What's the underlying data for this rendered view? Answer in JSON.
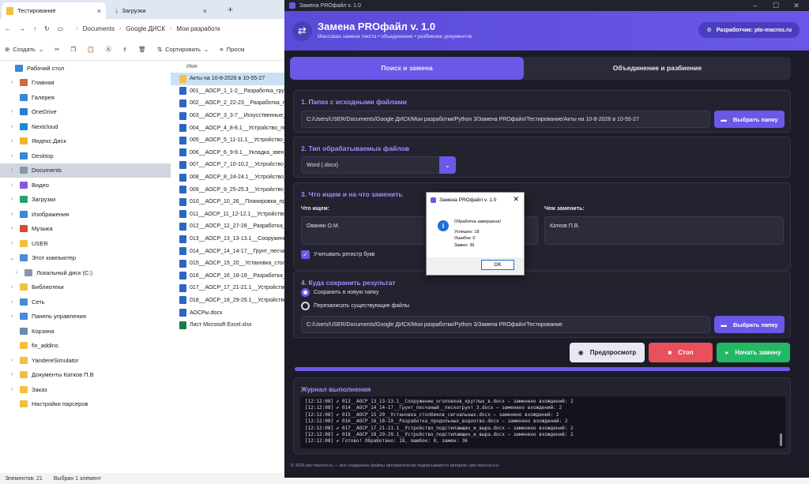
{
  "explorer": {
    "tabs": [
      {
        "label": "Тестирование"
      },
      {
        "label": "Загрузки"
      }
    ],
    "breadcrumb": [
      "Documents",
      "Google ДИСК",
      "Мои разработк"
    ],
    "toolbar": {
      "create": "Создать",
      "sort": "Сортировать",
      "view": "Просм"
    },
    "nav": [
      {
        "label": "Рабочий стол",
        "color": "#3a86d8",
        "chev": "",
        "sel": false,
        "indent": 0
      },
      {
        "label": "Главная",
        "color": "#d46a3a",
        "chev": "›",
        "sel": false,
        "indent": 1
      },
      {
        "label": "Галерея",
        "color": "#3a86d8",
        "chev": "",
        "sel": false,
        "indent": 1
      },
      {
        "label": "OneDrive",
        "color": "#2a7cd6",
        "chev": "›",
        "sel": false,
        "indent": 1
      },
      {
        "label": "Nextcloud",
        "color": "#1a8ad6",
        "chev": "›",
        "sel": false,
        "indent": 1
      },
      {
        "label": "Яндекс.Диск",
        "color": "#f0b429",
        "chev": "›",
        "sel": false,
        "indent": 1
      },
      {
        "label": "Desktop",
        "color": "#3a86d8",
        "chev": "›",
        "sel": false,
        "indent": 1
      },
      {
        "label": "Documents",
        "color": "#8a96a8",
        "chev": "›",
        "sel": true,
        "indent": 1
      },
      {
        "label": "Видео",
        "color": "#8a5ad6",
        "chev": "›",
        "sel": false,
        "indent": 1
      },
      {
        "label": "Загрузки",
        "color": "#2aa06a",
        "chev": "›",
        "sel": false,
        "indent": 1
      },
      {
        "label": "Изображения",
        "color": "#3a86d8",
        "chev": "›",
        "sel": false,
        "indent": 1
      },
      {
        "label": "Музыка",
        "color": "#d64a3a",
        "chev": "›",
        "sel": false,
        "indent": 1
      },
      {
        "label": "USER",
        "color": "#f0c040",
        "chev": "›",
        "sel": false,
        "indent": 1
      },
      {
        "label": "Этот компьютер",
        "color": "#4a8ad6",
        "chev": "⌄",
        "sel": false,
        "indent": 1
      },
      {
        "label": "Локальный диск (C:)",
        "color": "#8a96a8",
        "chev": "›",
        "sel": false,
        "indent": 2
      },
      {
        "label": "Библиотеки",
        "color": "#f0c040",
        "chev": "›",
        "sel": false,
        "indent": 1
      },
      {
        "label": "Сеть",
        "color": "#4a8ad6",
        "chev": "›",
        "sel": false,
        "indent": 1
      },
      {
        "label": "Панель управления",
        "color": "#4a8ad6",
        "chev": "›",
        "sel": false,
        "indent": 1
      },
      {
        "label": "Корзина",
        "color": "#6a8ab0",
        "chev": "",
        "sel": false,
        "indent": 1
      },
      {
        "label": "fix_addins",
        "color": "#f0c040",
        "chev": "",
        "sel": false,
        "indent": 1
      },
      {
        "label": "YandereSimulator",
        "color": "#f0c040",
        "chev": "›",
        "sel": false,
        "indent": 1
      },
      {
        "label": "Документы Катков П.В",
        "color": "#f0c040",
        "chev": "›",
        "sel": false,
        "indent": 1
      },
      {
        "label": "Заказ",
        "color": "#f0c040",
        "chev": "›",
        "sel": false,
        "indent": 1
      },
      {
        "label": "Настройки парсеров",
        "color": "#f0c040",
        "chev": "",
        "sel": false,
        "indent": 1
      }
    ],
    "files_header": "Имя",
    "files": [
      {
        "name": "Акты на 10-8-2026 в 10-55-27",
        "kind": "folder",
        "sel": true
      },
      {
        "name": "001__АОСР_1_1-2__Разработка_грунт",
        "kind": "word",
        "sel": false
      },
      {
        "name": "002__АОСР_2_22-23__Разработка_гру",
        "kind": "word",
        "sel": false
      },
      {
        "name": "003__АОСР_3_3-7__Искусственные_с",
        "kind": "word",
        "sel": false
      },
      {
        "name": "004__АОСР_4_8-8.1__Устройство_под",
        "kind": "word",
        "sel": false
      },
      {
        "name": "005__АОСР_5_11-11.1__Устройство_п",
        "kind": "word",
        "sel": false
      },
      {
        "name": "006__АОСР_6_9-9.1__Укладка_звенье",
        "kind": "word",
        "sel": false
      },
      {
        "name": "007__АОСР_7_10-10.2__Устройство_п",
        "kind": "word",
        "sel": false
      },
      {
        "name": "008__АОСР_8_24-24.1__Устройство_п",
        "kind": "word",
        "sel": false
      },
      {
        "name": "009__АОСР_9_25-25.3__Устройство_п",
        "kind": "word",
        "sel": false
      },
      {
        "name": "010__АОСР_10_26__Планировка_при",
        "kind": "word",
        "sel": false
      },
      {
        "name": "011__АОСР_11_12-12.1__Устройство_",
        "kind": "word",
        "sel": false
      },
      {
        "name": "012__АОСР_12_27-28__Разработка_гр",
        "kind": "word",
        "sel": false
      },
      {
        "name": "013__АОСР_13_13-13.1__Сооружение_",
        "kind": "word",
        "sel": false
      },
      {
        "name": "014__АОСР_14_14-17__Грунт_песчаны",
        "kind": "word",
        "sel": false
      },
      {
        "name": "015__АОСР_15_20__Установка_столби",
        "kind": "word",
        "sel": false
      },
      {
        "name": "016__АОСР_16_18-19__Разработка_пр",
        "kind": "word",
        "sel": false
      },
      {
        "name": "017__АОСР_17_21-21.1__Устройство_",
        "kind": "word",
        "sel": false
      },
      {
        "name": "018__АОСР_18_29-29.1__Устройство_",
        "kind": "word",
        "sel": false
      },
      {
        "name": "АОСРы.docx",
        "kind": "word",
        "sel": false
      },
      {
        "name": "Лист Microsoft Excel.xlsx",
        "kind": "excel",
        "sel": false
      }
    ],
    "status": {
      "count": "Элементов: 21",
      "selected": "Выбран 1 элемент"
    }
  },
  "app": {
    "window_title": "Замена PROфайл v. 1.0",
    "title": "Замена PROфайл v. 1.0",
    "subtitle": "Массовая замена текста  •  объединение  •  разбиение документов",
    "dev_button": "Разработчик: pto-macros.ru",
    "tab_search": "Поиск и замена",
    "tab_merge": "Объединение и разбиение",
    "s1_title": "1.  Папка с исходными файлами",
    "s1_path": "C:/Users/USER/Documents/Google ДИСК/Мои разработки/Python 3/Замена PROфайл/Тестирование/Акты на 10-8-2026 в 10-55-27",
    "browse": "Выбрать папку",
    "s2_title": "2.  Тип обрабатываемых файлов",
    "filetype": "Word (.docx)",
    "s3_title": "3.  Что ищем и на что заменить",
    "find_label": "Что ищем:",
    "find_value": "Ованян О.М.",
    "replace_label": "Чем заменить:",
    "replace_value": "Катков П.В.",
    "case_label": "Учитывать регистр букв",
    "s4_title": "4.  Куда сохранить результат",
    "opt_new": "Сохранить в новую папку",
    "opt_overwrite": "Перезаписать существующие файлы",
    "s4_path": "C:/Users/USER/Documents/Google ДИСК/Мои разработки/Python 3/Замена PROфайл/Тестирование",
    "btn_preview": "Предпросмотр",
    "btn_stop": "Стоп",
    "btn_start": "Начать замену",
    "progress": 1.0,
    "log_title": "Журнал выполнения",
    "log_lines": [
      "[12:12:08] ✔ 013__АОСР_13_13-13.1__Сооружение_оголовков_круглых_в.docx — заменено вхождений: 2",
      "[12:12:08] ✔ 014__АОСР_14_14-17__Грунт_песчаный__пескогрунт_3.docx — заменено вхождений: 2",
      "[12:12:08] ✔ 015__АОСР_15_20__Установка_столбиков_сигнальных.docx — заменено вхождений: 2",
      "[12:12:08] ✔ 016__АОСР_16_18-19__Разработка_продольных_водоотво.docx — заменено вхождений: 2",
      "[12:12:08] ✔ 017__АОСР_17_21-21.1__Устройство_подстилающих_и_выра.docx — заменено вхождений: 2",
      "[12:12:08] ✔ 018__АОСР_18_29-29.1__Устройство_подстилающих_и_выра.docx — заменено вхождений: 2",
      "[12:12:08] ✔ Готово! Обработано: 18, ошибок: 0, замен: 36"
    ],
    "footer": "© 2026 pto-macros.ru — все созданные файлы автоматически подписываются автором «pto-macros.ru»"
  },
  "dialog": {
    "title": "Замена PROфайл v. 1.0",
    "heading": "Обработка завершена!",
    "line1": "Успешно: 18",
    "line2": "Ошибок: 0",
    "line3": "Замен: 36",
    "ok": "OK"
  },
  "colors": {
    "accent": "#6b58e8",
    "stop": "#e8505b",
    "start": "#22b864",
    "preview": "#e8e8f4"
  }
}
